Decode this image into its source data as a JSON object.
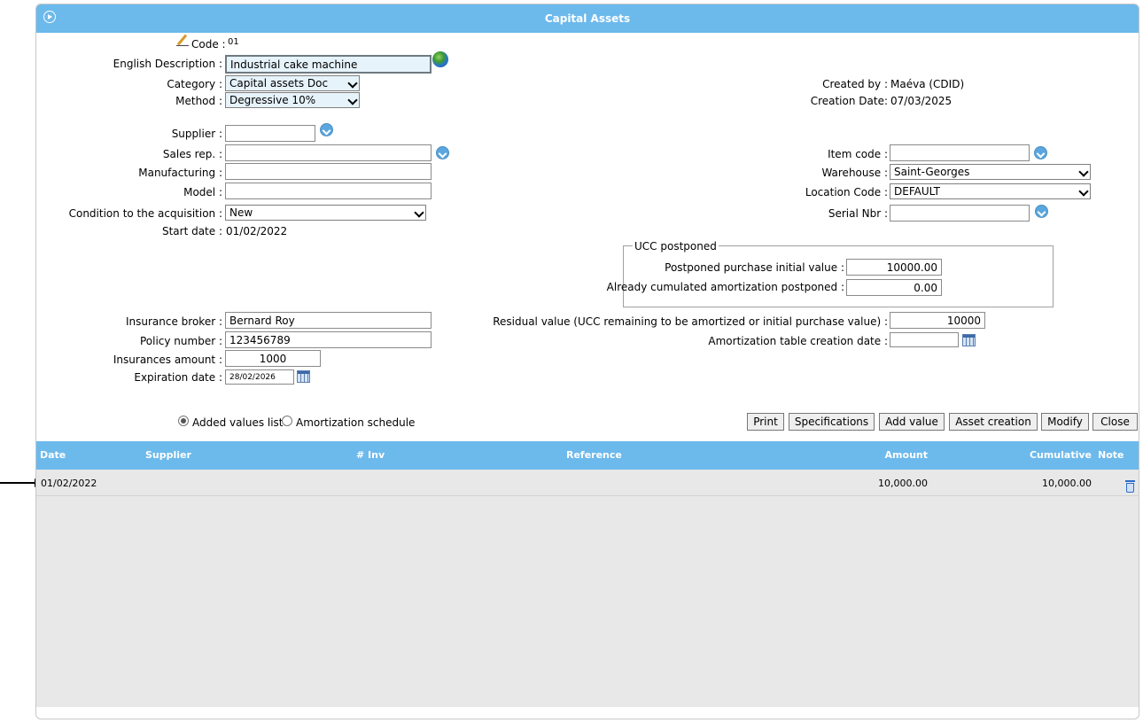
{
  "window": {
    "title": "Capital Assets"
  },
  "form": {
    "code_label": "Code :",
    "code_value": "01",
    "english_description_label": "English Description :",
    "english_description_value": "Industrial cake machine",
    "category_label": "Category :",
    "category_value": "Capital assets Doc",
    "method_label": "Method :",
    "method_value": "Degressive 10%",
    "created_by_label": "Created by :",
    "created_by_value": "Maéva (CDID)",
    "creation_date_label": "Creation Date:",
    "creation_date_value": "07/03/2025",
    "supplier_label": "Supplier :",
    "supplier_value": "",
    "sales_rep_label": "Sales rep. :",
    "sales_rep_value": "",
    "manufacturing_label": "Manufacturing :",
    "manufacturing_value": "",
    "model_label": "Model :",
    "model_value": "",
    "condition_label": "Condition to the acquisition :",
    "condition_value": "New",
    "start_date_label": "Start date :",
    "start_date_value": "01/02/2022",
    "item_code_label": "Item code :",
    "item_code_value": "",
    "warehouse_label": "Warehouse :",
    "warehouse_value": "Saint-Georges",
    "location_code_label": "Location Code :",
    "location_code_value": "DEFAULT",
    "serial_nbr_label": "Serial Nbr :",
    "serial_nbr_value": "",
    "ucc_legend": "UCC postponed",
    "postponed_initial_label": "Postponed purchase initial value :",
    "postponed_initial_value": "10000.00",
    "already_cumulated_label": "Already cumulated amortization postponed :",
    "already_cumulated_value": "0.00",
    "residual_label": "Residual value (UCC remaining to be amortized or initial purchase value) :",
    "residual_value": "10000",
    "amort_table_date_label": "Amortization table creation date :",
    "amort_table_date_value": "",
    "insurance_broker_label": "Insurance broker :",
    "insurance_broker_value": "Bernard Roy",
    "policy_number_label": "Policy number :",
    "policy_number_value": "123456789",
    "insurances_amount_label": "Insurances amount :",
    "insurances_amount_value": "1000",
    "expiration_date_label": "Expiration date :",
    "expiration_date_value": "28/02/2026"
  },
  "view_options": {
    "added_values": "Added values list",
    "amortization_schedule": "Amortization schedule",
    "selected": "added_values"
  },
  "buttons": {
    "print": "Print",
    "specifications": "Specifications",
    "add_value": "Add value",
    "asset_creation": "Asset creation",
    "modify": "Modify",
    "close": "Close"
  },
  "grid": {
    "headers": {
      "date": "Date",
      "supplier": "Supplier",
      "inv": "# Inv",
      "reference": "Reference",
      "amount": "Amount",
      "cumulative": "Cumulative",
      "note": "Note"
    },
    "rows": [
      {
        "date": "01/02/2022",
        "supplier": "",
        "inv": "",
        "reference": "",
        "amount": "10,000.00",
        "cumulative": "10,000.00"
      }
    ]
  },
  "colors": {
    "header_blue": "#6cb9ec",
    "grid_bg": "#e8e8e8",
    "field_highlight": "#e6f3fb"
  },
  "icons": [
    "nav-arrow-icon",
    "pencil-icon",
    "globe-icon",
    "dropdown-circle-icon",
    "calendar-icon",
    "trash-icon",
    "row-pointer-arrow-icon"
  ]
}
